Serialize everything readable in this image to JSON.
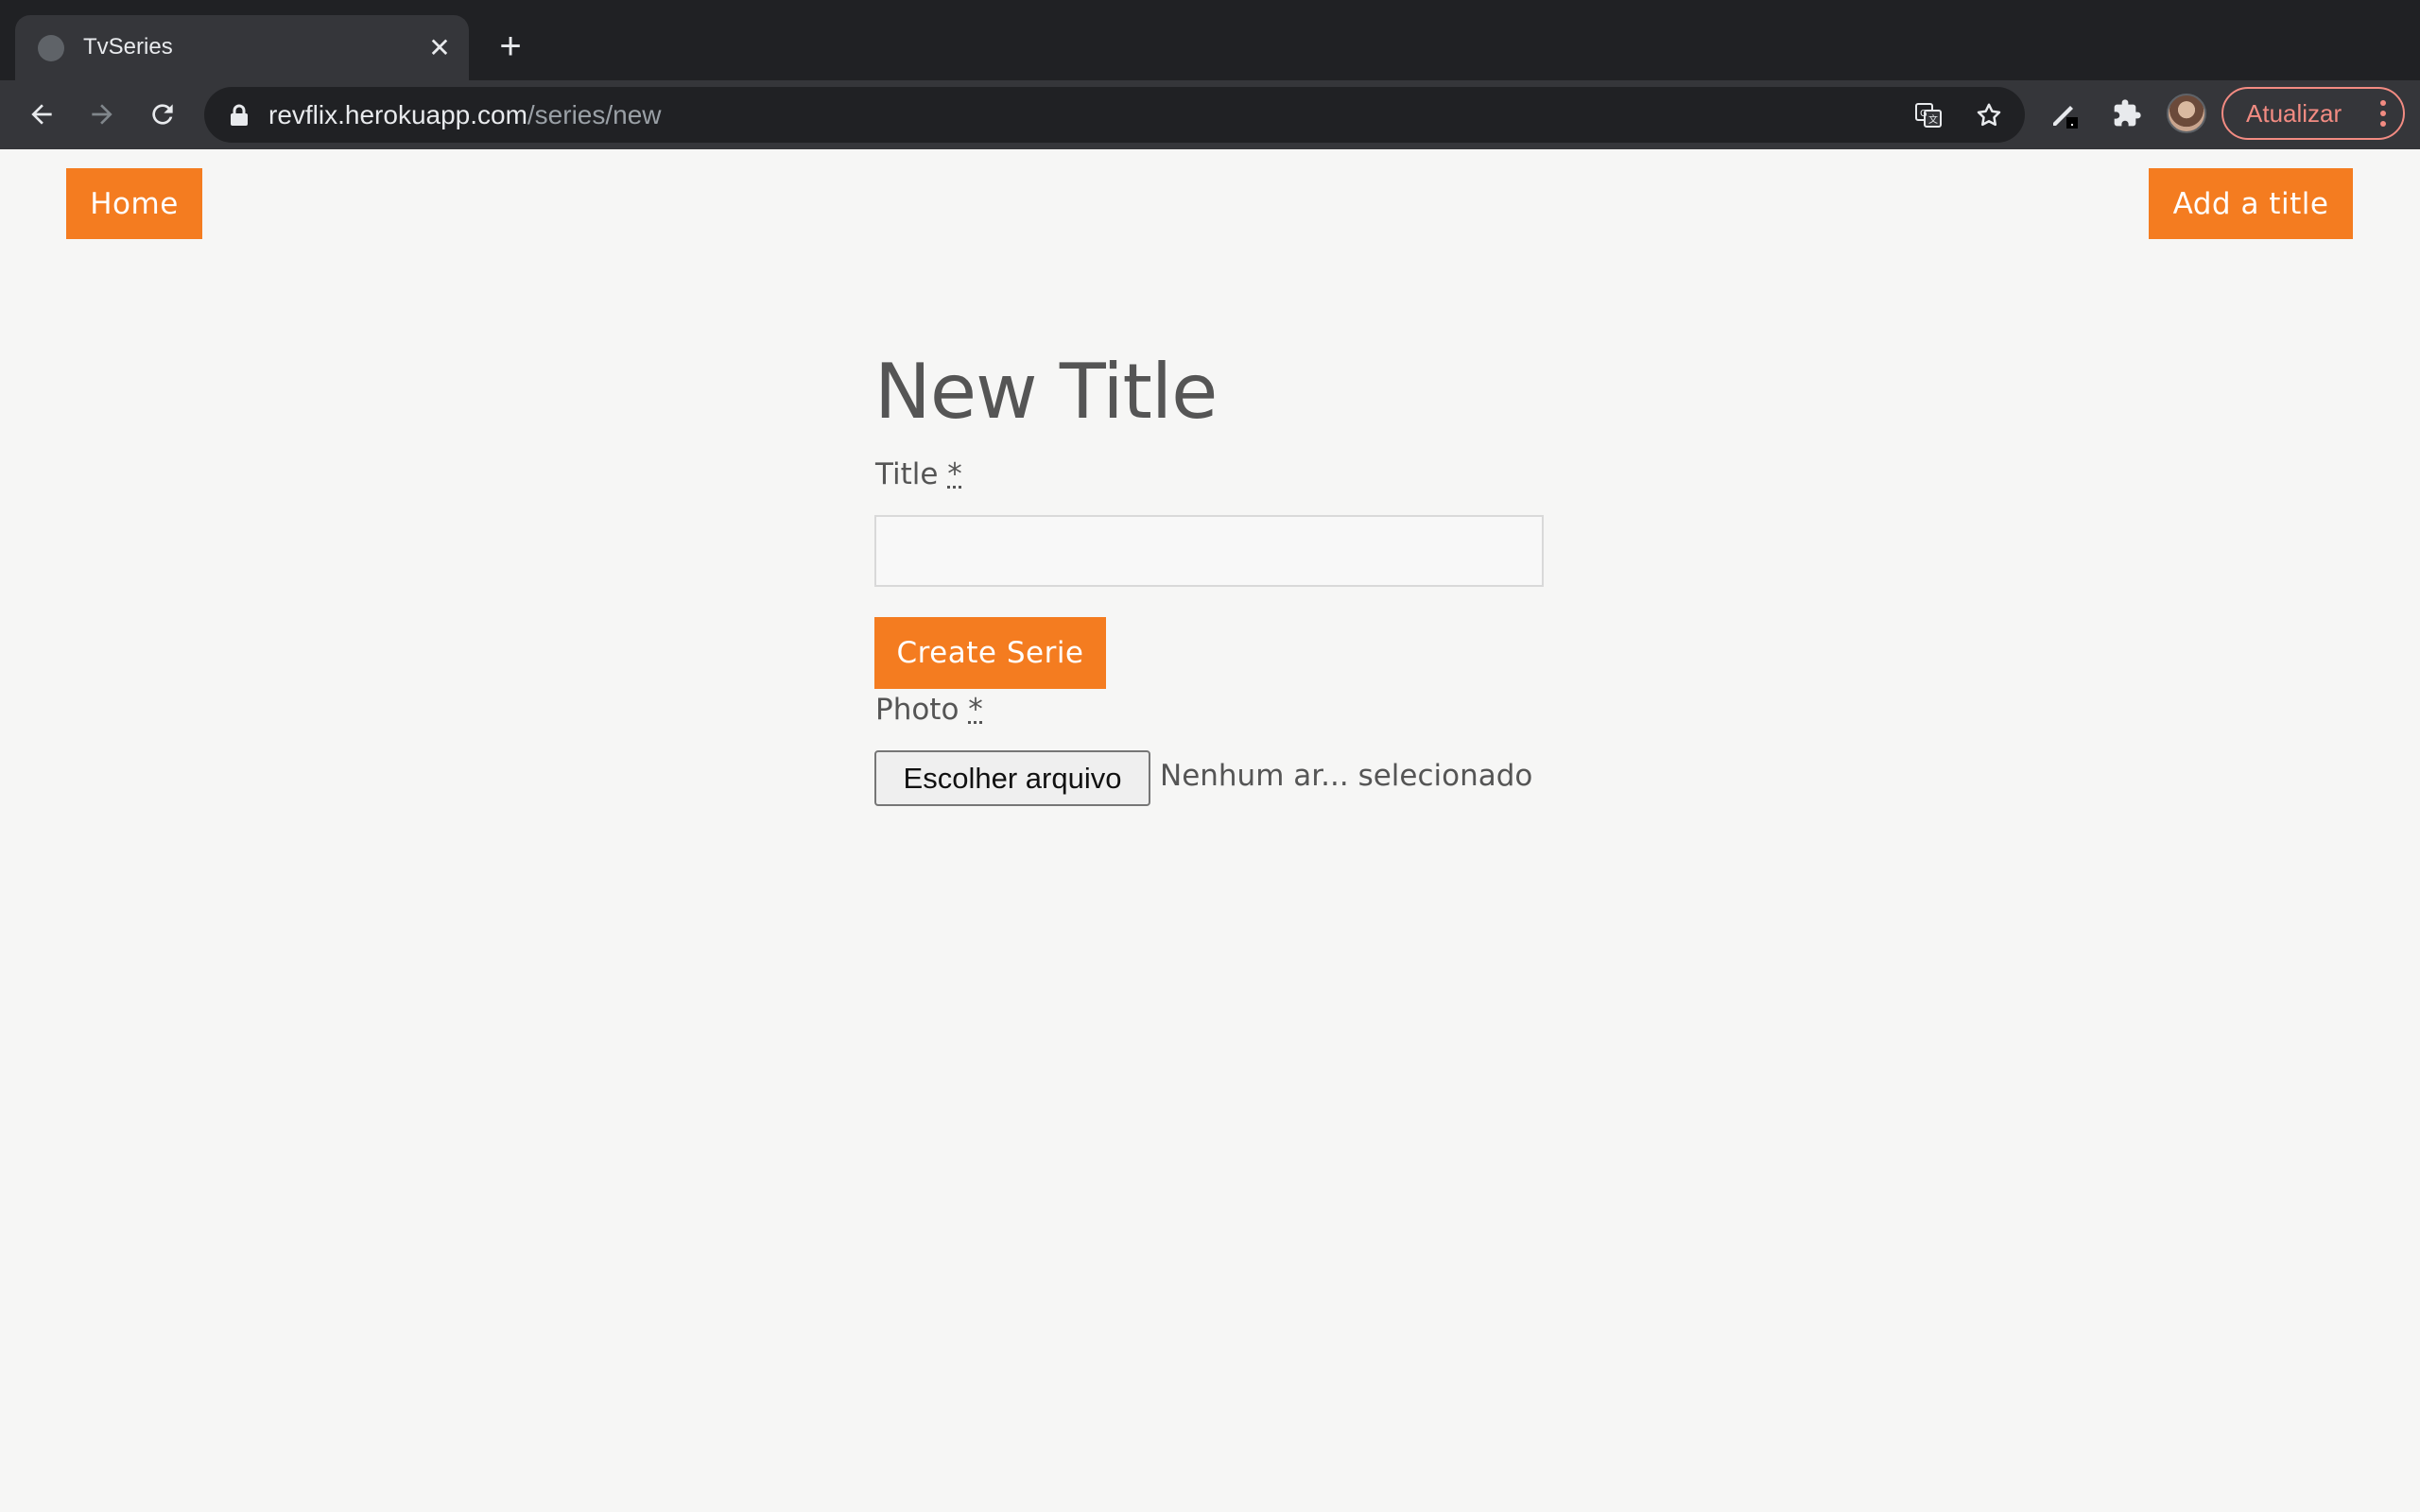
{
  "browser": {
    "tab": {
      "title": "TvSeries"
    },
    "address": {
      "host": "revflix.herokuapp.com",
      "path": "/series/new"
    },
    "update_label": "Atualizar"
  },
  "nav": {
    "home_label": "Home",
    "add_label": "Add a title"
  },
  "form": {
    "heading": "New Title",
    "title_label": "Title",
    "required_mark": "*",
    "title_value": "",
    "submit_label": "Create Serie",
    "photo_label": "Photo",
    "file_button_label": "Escolher arquivo",
    "file_status": "Nenhum ar... selecionado"
  },
  "colors": {
    "accent": "#f47c20",
    "text": "#555555",
    "background": "#f6f6f5"
  }
}
